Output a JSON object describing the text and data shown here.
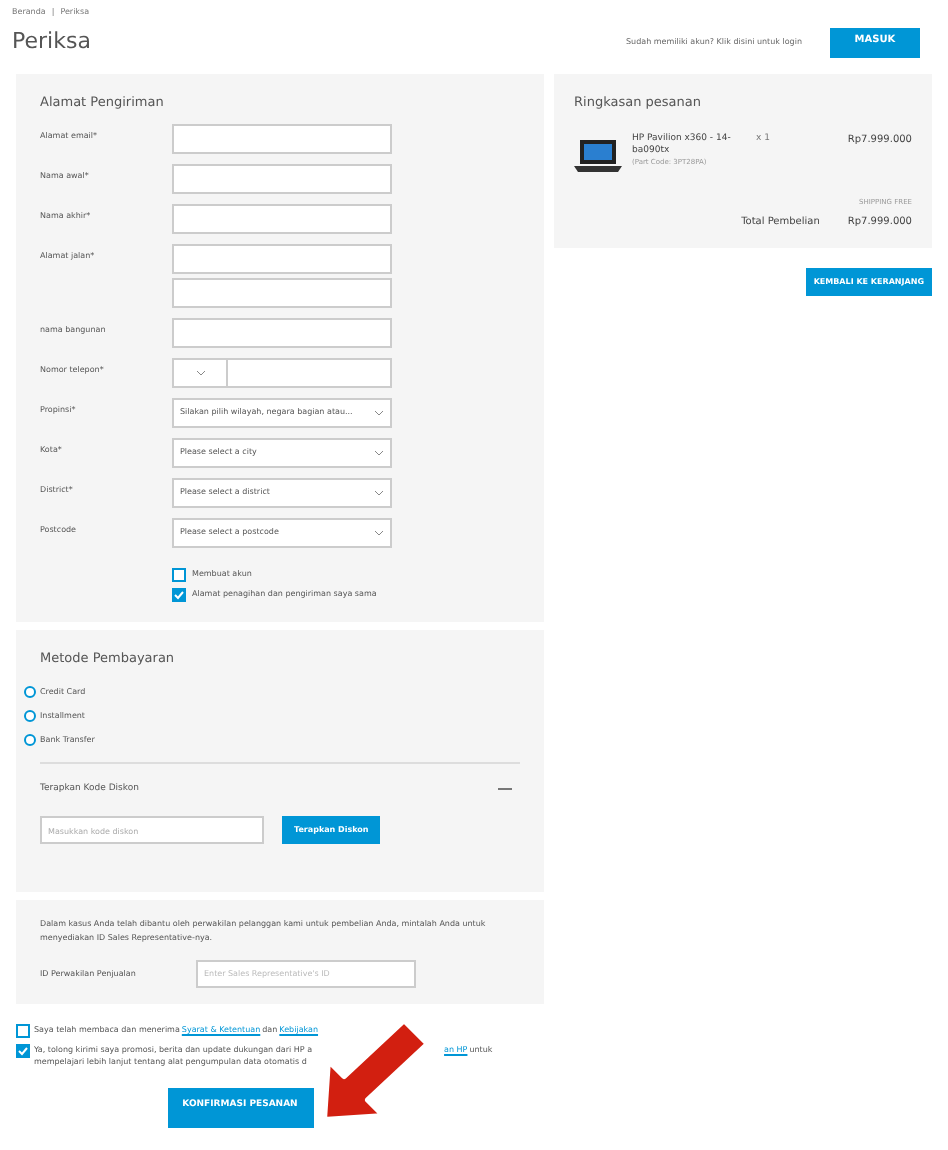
{
  "breadcrumb": [
    "Beranda",
    "|",
    "Periksa"
  ],
  "page_title": "Periksa",
  "login": {
    "prompt": "Sudah memiliki akun? Klik disini untuk login",
    "button": "MASUK"
  },
  "shipping": {
    "title": "Alamat Pengiriman",
    "fields": [
      {
        "label": "Alamat email*",
        "kind": "input"
      },
      {
        "label": "Nama awal*",
        "kind": "input"
      },
      {
        "label": "Nama akhir*",
        "kind": "input"
      },
      {
        "label": "Alamat jalan*",
        "kind": "input2"
      },
      {
        "label": "nama bangunan",
        "kind": "input"
      },
      {
        "label": "Nomor telepon*",
        "kind": "phone"
      },
      {
        "label": "Propinsi*",
        "kind": "select",
        "value": "Silakan pilih wilayah, negara bagian atau..."
      },
      {
        "label": "Kota*",
        "kind": "select",
        "value": "Please select a city"
      },
      {
        "label": "District*",
        "kind": "select",
        "value": "Please select a district"
      },
      {
        "label": "Postcode",
        "kind": "select",
        "value": "Please select a postcode"
      }
    ],
    "checkboxes": [
      {
        "label": "Membuat akun",
        "checked": false
      },
      {
        "label": "Alamat penagihan dan pengiriman saya sama",
        "checked": true
      }
    ]
  },
  "summary": {
    "title": "Ringkasan pesanan",
    "item": {
      "name": "HP Pavilion x360 - 14-ba090tx",
      "part_code": "(Part Code: 3PT28PA)",
      "qty": "x 1",
      "price": "Rp7.999.000"
    },
    "shipping": "SHIPPING FREE",
    "total_label": "Total Pembelian",
    "total": "Rp7.999.000"
  },
  "back_button": "KEMBALI KE KERANJANG",
  "payment": {
    "title": "Metode Pembayaran",
    "options": [
      {
        "label": "Credit Card",
        "selected": false
      },
      {
        "label": "Installment",
        "selected": false
      },
      {
        "label": "Bank Transfer",
        "selected": false
      }
    ],
    "discount": {
      "title": "Terapkan Kode Diskon",
      "expanded": true,
      "placeholder": "Masukkan kode diskon",
      "button": "Terapkan Diskon"
    }
  },
  "representative": {
    "note": "Dalam kasus Anda telah dibantu oleh perwakilan pelanggan kami untuk pembelian Anda, mintalah Anda untuk menyediakan ID Sales Representative-nya.",
    "label": "ID Perwakilan Penjualan",
    "placeholder": "Enter Sales Representative's ID"
  },
  "consents": [
    {
      "parts": [
        "Saya telah membaca dan menerima ",
        "Syarat & Ketentuan",
        " dan ",
        "Kebijakan"
      ],
      "checked": false
    },
    {
      "parts": [
        "Ya, tolong kirimi saya promosi, berita dan update dukungan dari HP a",
        "an HP",
        " untuk"
      ],
      "line2": "mempelajari lebih lanjut tentang alat pengumpulan data otomatis d",
      "checked": true
    }
  ],
  "confirm_button": "KONFIRMASI PESANAN"
}
